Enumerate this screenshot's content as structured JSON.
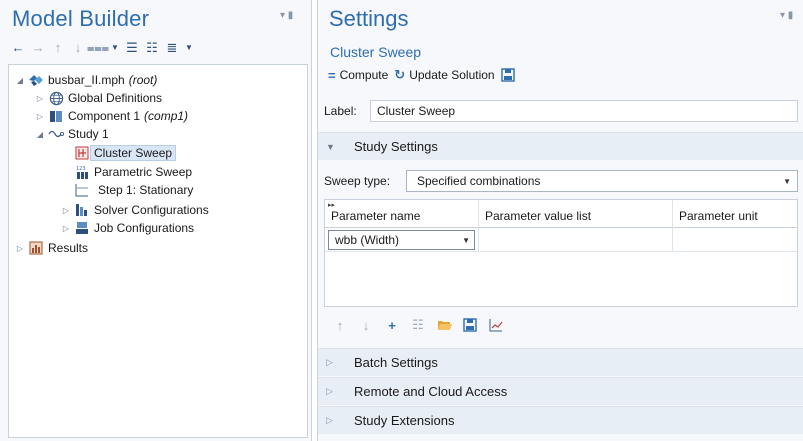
{
  "model_builder": {
    "title": "Model Builder",
    "tree": {
      "root": {
        "label": "busbar_II.mph",
        "tag": "(root)"
      },
      "global_definitions": {
        "label": "Global Definitions"
      },
      "component": {
        "label": "Component 1",
        "tag": "(comp1)"
      },
      "study": {
        "label": "Study 1"
      },
      "cluster_sweep": {
        "label": "Cluster Sweep"
      },
      "parametric_sweep": {
        "label": "Parametric Sweep"
      },
      "step1": {
        "label": "Step 1: Stationary"
      },
      "solver_configurations": {
        "label": "Solver Configurations"
      },
      "job_configurations": {
        "label": "Job Configurations"
      },
      "results": {
        "label": "Results"
      }
    }
  },
  "settings": {
    "title": "Settings",
    "subtitle": "Cluster Sweep",
    "toolbar": {
      "compute": "Compute",
      "update_solution": "Update Solution"
    },
    "label_field": {
      "label": "Label:",
      "value": "Cluster Sweep"
    },
    "sections": {
      "study_settings": "Study Settings",
      "batch_settings": "Batch Settings",
      "remote_cloud": "Remote and Cloud Access",
      "study_extensions": "Study Extensions"
    },
    "sweep_type": {
      "label": "Sweep type:",
      "value": "Specified combinations"
    },
    "table": {
      "columns": [
        "Parameter name",
        "Parameter value list",
        "Parameter unit"
      ],
      "rows": [
        {
          "parameter_name": "wbb (Width)",
          "value_list": "",
          "unit": ""
        }
      ]
    }
  }
}
